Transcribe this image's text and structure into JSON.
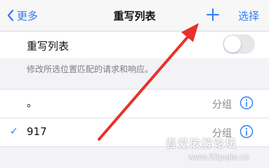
{
  "navbar": {
    "back_label": "更多",
    "title": "重写列表",
    "add_icon": "plus-icon",
    "select_label": "选择"
  },
  "toggle_row": {
    "label": "重写列表",
    "enabled": false
  },
  "footnote": "修改所选位置匹配的请求和响应。",
  "list": {
    "items": [
      {
        "label": "。",
        "group": "分组",
        "checked": false
      },
      {
        "label": "917",
        "group": "分组",
        "checked": true
      }
    ]
  },
  "colors": {
    "accent": "#2f7cf6",
    "annotation_arrow": "#e8312a",
    "background": "#f2f2f7"
  },
  "watermark": {
    "line1": "吾爱破解论坛",
    "line2": "www.52pojie.cn"
  }
}
